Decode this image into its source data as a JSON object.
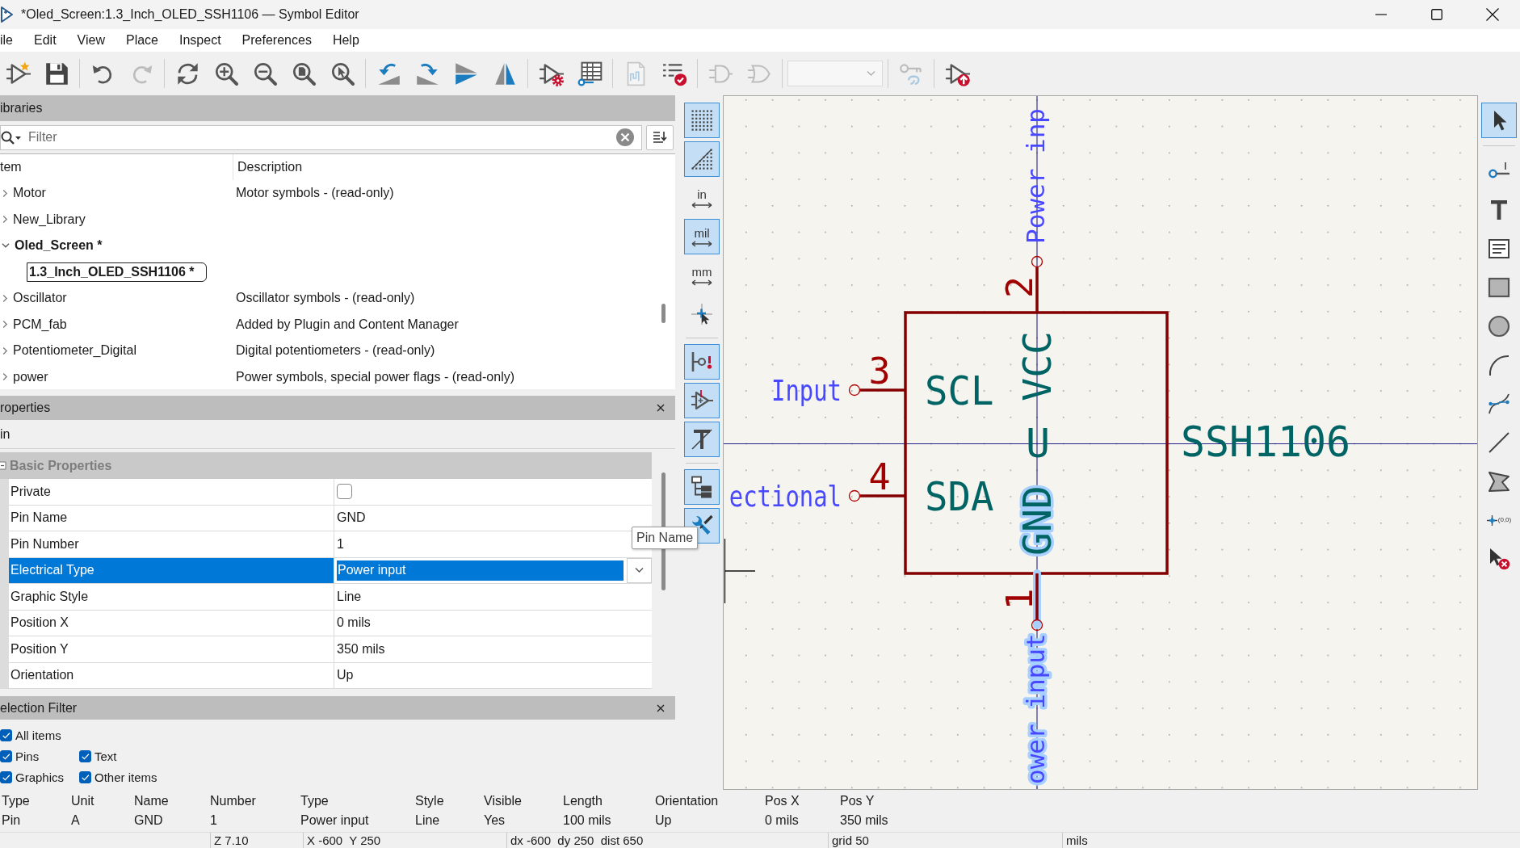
{
  "window": {
    "title": "*Oled_Screen:1.3_Inch_OLED_SSH1106 — Symbol Editor"
  },
  "menu": [
    "ile",
    "Edit",
    "View",
    "Place",
    "Inspect",
    "Preferences",
    "Help"
  ],
  "toolbar": [
    {
      "kind": "button",
      "disabled": false
    },
    {
      "kind": "button",
      "disabled": false
    },
    {
      "kind": "button",
      "disabled": false
    },
    {
      "kind": "button",
      "disabled": true
    },
    {
      "kind": "button",
      "disabled": false
    },
    {
      "kind": "button",
      "disabled": false
    },
    {
      "kind": "button",
      "disabled": false
    },
    {
      "kind": "button",
      "disabled": false
    },
    {
      "kind": "button",
      "disabled": false
    },
    {
      "kind": "button",
      "disabled": false
    },
    {
      "kind": "button",
      "disabled": false
    },
    {
      "kind": "button",
      "disabled": false
    },
    {
      "kind": "button",
      "disabled": false
    },
    {
      "kind": "button",
      "disabled": false
    },
    {
      "kind": "button",
      "disabled": false
    },
    {
      "kind": "button",
      "disabled": true
    },
    {
      "kind": "button",
      "disabled": false
    },
    {
      "kind": "button",
      "disabled": true
    },
    {
      "kind": "button",
      "disabled": true
    },
    {
      "kind": "dropdown",
      "disabled": true
    },
    {
      "kind": "button",
      "disabled": true
    },
    {
      "kind": "button",
      "disabled": false
    }
  ],
  "libraries": {
    "title": "ibraries",
    "filter": {
      "placeholder": "Filter"
    },
    "columns": [
      "tem",
      "Description"
    ],
    "rows": [
      {
        "name": "Motor",
        "description": "Motor symbols - (read-only)",
        "expanded": false,
        "current": false,
        "selected": false
      },
      {
        "name": "New_Library",
        "expanded": false,
        "current": false,
        "selected": false
      },
      {
        "name": "Oled_Screen *",
        "expanded": true,
        "current": true,
        "selected": false,
        "children": [
          {
            "name": "1.3_Inch_OLED_SSH1106 *",
            "current": true,
            "selected": true
          }
        ]
      },
      {
        "name": "Oscillator",
        "description": "Oscillator symbols - (read-only)",
        "expanded": false,
        "current": false,
        "selected": false
      },
      {
        "name": "PCM_fab",
        "description": "Added by Plugin and Content Manager",
        "expanded": false,
        "current": false,
        "selected": false
      },
      {
        "name": "Potentiometer_Digital",
        "description": "Digital potentiometers - (read-only)",
        "expanded": false,
        "current": false,
        "selected": false
      },
      {
        "name": "power",
        "description": "Power symbols, special power flags - (read-only)",
        "expanded": false,
        "current": false,
        "selected": false
      }
    ]
  },
  "properties": {
    "title": "roperties",
    "object": "in",
    "group": {
      "label": "Basic Properties",
      "expanded": true
    },
    "rows": [
      {
        "name": "Private",
        "kind": "checkbox",
        "checked": false,
        "selected": false
      },
      {
        "name": "Pin Name",
        "kind": "text",
        "value": "GND",
        "selected": false
      },
      {
        "name": "Pin Number",
        "kind": "text",
        "value": "1",
        "selected": false
      },
      {
        "name": "Electrical Type",
        "kind": "dropdown",
        "value": "Power input",
        "selected": true
      },
      {
        "name": "Graphic Style",
        "kind": "text",
        "value": "Line",
        "selected": false
      },
      {
        "name": "Position X",
        "kind": "text",
        "value": "0 mils",
        "selected": false
      },
      {
        "name": "Position Y",
        "kind": "text",
        "value": "350 mils",
        "selected": false
      },
      {
        "name": "Orientation",
        "kind": "text",
        "value": "Up",
        "selected": false
      }
    ]
  },
  "selection_filter": {
    "title": "election Filter",
    "options": [
      {
        "label": "All items",
        "checked": true
      },
      {
        "label": "Pins",
        "checked": true
      },
      {
        "label": "Text",
        "checked": true
      },
      {
        "label": "Graphics",
        "checked": true
      },
      {
        "label": "Other items",
        "checked": true
      }
    ]
  },
  "canvas_toolbar": [
    {
      "selected": true
    },
    {
      "selected": true
    },
    {
      "label": "in",
      "selected": false
    },
    {
      "label": "mil",
      "selected": true
    },
    {
      "label": "mm",
      "selected": false
    },
    {
      "selected": false
    },
    {
      "selected": true
    },
    {
      "selected": true
    },
    {
      "selected": true
    },
    {
      "selected": true
    },
    {
      "selected": true
    }
  ],
  "canvas": {
    "reference": "U",
    "value": "SSH1106",
    "pins": [
      {
        "number": "2",
        "name": "VCC",
        "type": "Power inp",
        "kind": "top",
        "selected": false
      },
      {
        "number": "3",
        "name": "SCL",
        "type": "Input",
        "kind": "left",
        "selected": false
      },
      {
        "number": "4",
        "name": "SDA",
        "type": "ectional",
        "kind": "left",
        "selected": false
      },
      {
        "number": "1",
        "name": "GND",
        "type": "ower input",
        "kind": "bottom",
        "selected": true
      }
    ]
  },
  "drawing_tools": [
    {
      "selected": true
    },
    {
      "selected": false
    },
    {
      "selected": false
    },
    {
      "selected": false
    },
    {
      "selected": false
    },
    {
      "selected": false
    },
    {
      "selected": false
    },
    {
      "selected": false
    },
    {
      "selected": false
    },
    {
      "selected": false
    },
    {
      "label": "(0,0)",
      "selected": false
    },
    {
      "selected": false
    }
  ],
  "tooltip": "Pin Name",
  "message_panel": [
    {
      "label": "Type",
      "value": "Pin"
    },
    {
      "label": "Unit",
      "value": "A"
    },
    {
      "label": "Name",
      "value": "GND"
    },
    {
      "label": "Number",
      "value": "1"
    },
    {
      "label": "Type",
      "value": "Power input"
    },
    {
      "label": "Style",
      "value": "Line"
    },
    {
      "label": "Visible",
      "value": "Yes"
    },
    {
      "label": "Length",
      "value": "100 mils"
    },
    {
      "label": "Orientation",
      "value": "Up"
    },
    {
      "label": "Pos X",
      "value": "0 mils"
    },
    {
      "label": "Pos Y",
      "value": "350 mils"
    }
  ],
  "status_bar": [
    "Z 7.10",
    "X -600  Y 250",
    "dx -600  dy 250  dist 650",
    "grid 50",
    "mils"
  ]
}
